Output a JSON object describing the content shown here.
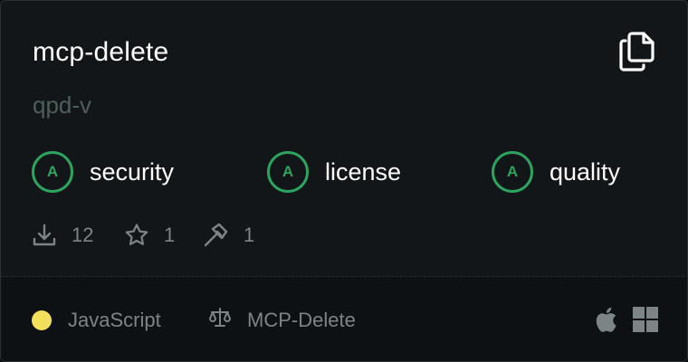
{
  "card": {
    "title": "mcp-delete",
    "author": "qpd-v",
    "copy_icon": "copy-icon"
  },
  "scores": [
    {
      "grade": "A",
      "label": "security"
    },
    {
      "grade": "A",
      "label": "license"
    },
    {
      "grade": "A",
      "label": "quality"
    }
  ],
  "stats": {
    "downloads": "12",
    "stars": "1",
    "tools": "1"
  },
  "footer": {
    "language": "JavaScript",
    "language_color": "#f2df5c",
    "license_name": "MCP-Delete",
    "platforms": [
      "apple-icon",
      "windows-icon"
    ]
  },
  "colors": {
    "grade_green": "#2ea35e",
    "muted_text": "#7d8488",
    "author_text": "#4c5f5b"
  }
}
